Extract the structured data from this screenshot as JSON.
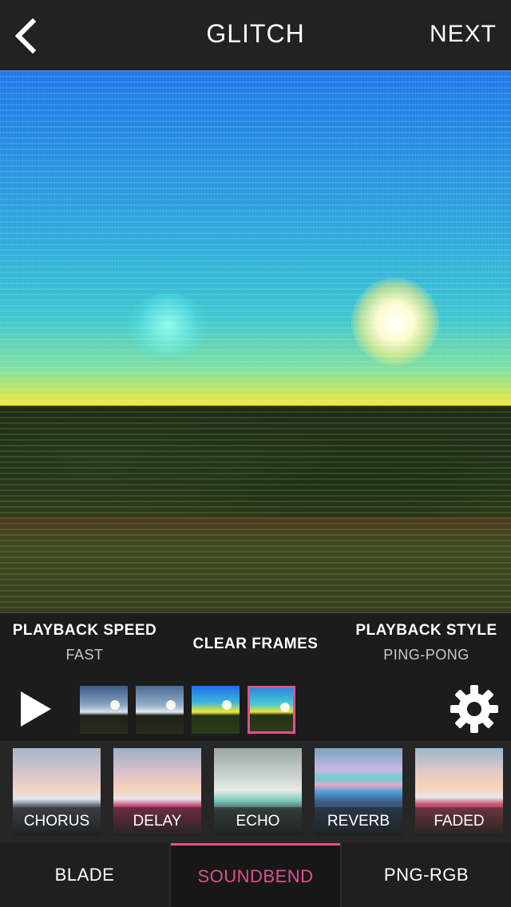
{
  "header": {
    "title": "GLITCH",
    "next_label": "NEXT",
    "back_icon": "chevron-left-icon"
  },
  "controls": {
    "playback_speed": {
      "label": "PLAYBACK SPEED",
      "value": "FAST"
    },
    "clear_frames": {
      "label": "CLEAR FRAMES"
    },
    "playback_style": {
      "label": "PLAYBACK STYLE",
      "value": "PING-PONG"
    }
  },
  "frames": {
    "play_icon": "play-icon",
    "settings_icon": "gear-icon",
    "count": 4,
    "selected_index": 3
  },
  "filters": [
    {
      "label": "CHORUS"
    },
    {
      "label": "DELAY"
    },
    {
      "label": "ECHO"
    },
    {
      "label": "REVERB"
    },
    {
      "label": "FADED"
    }
  ],
  "tabs": [
    {
      "label": "BLADE",
      "active": false
    },
    {
      "label": "SOUNDBEND",
      "active": true
    },
    {
      "label": "PNG-RGB",
      "active": false
    }
  ],
  "colors": {
    "accent": "#e0508f",
    "bar_background": "#222222"
  }
}
